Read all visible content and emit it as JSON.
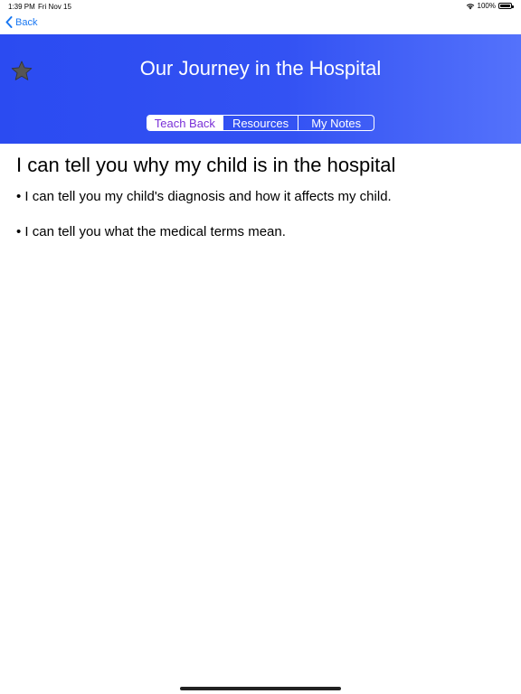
{
  "status_bar": {
    "time": "1:39 PM",
    "date": "Fri Nov 15",
    "battery": "100%"
  },
  "nav": {
    "back_label": "Back"
  },
  "header": {
    "title": "Our Journey in the Hospital",
    "tabs": [
      {
        "label": "Teach Back",
        "active": true
      },
      {
        "label": "Resources",
        "active": false
      },
      {
        "label": "My Notes",
        "active": false
      }
    ]
  },
  "content": {
    "title": "I can tell you why my child is in the hospital",
    "bullets": [
      "• I can tell you my child's diagnosis and how it affects my child.",
      "• I can tell you what the medical terms mean."
    ]
  },
  "icons": {
    "favorite": "star-icon",
    "back": "chevron-left-icon",
    "wifi": "wifi-icon",
    "battery": "battery-icon"
  },
  "colors": {
    "accent": "#1877f2",
    "header_start": "#2b4bf1",
    "header_end": "#5472fb",
    "active_tab_text": "#7a30d8"
  }
}
